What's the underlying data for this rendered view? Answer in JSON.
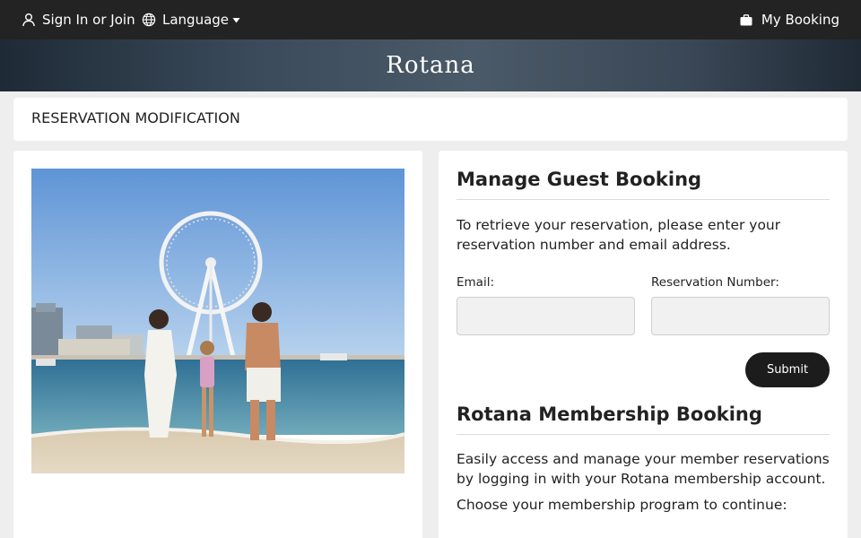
{
  "topbar": {
    "signin_label": "Sign In or Join",
    "language_label": "Language",
    "mybooking_label": "My Booking",
    "icons": [
      "user-icon",
      "globe-icon",
      "caret-down-icon",
      "briefcase-icon"
    ]
  },
  "brand": {
    "logo_text": "Rotana"
  },
  "page": {
    "title": "RESERVATION MODIFICATION"
  },
  "guest_booking": {
    "heading": "Manage Guest Booking",
    "instructions": "To retrieve your reservation, please enter your reservation number and email address.",
    "email_label": "Email:",
    "email_value": "",
    "reservation_label": "Reservation Number:",
    "reservation_value": "",
    "submit_label": "Submit"
  },
  "membership": {
    "heading": "Rotana Membership Booking",
    "description": "Easily access and manage your member reservations by logging in with your Rotana membership account.",
    "choose_prompt": "Choose your membership program to continue:"
  },
  "colors": {
    "topbar": "#232323",
    "button": "#1c1c1c",
    "card": "#ffffff",
    "page_bg": "#eeeeee"
  }
}
